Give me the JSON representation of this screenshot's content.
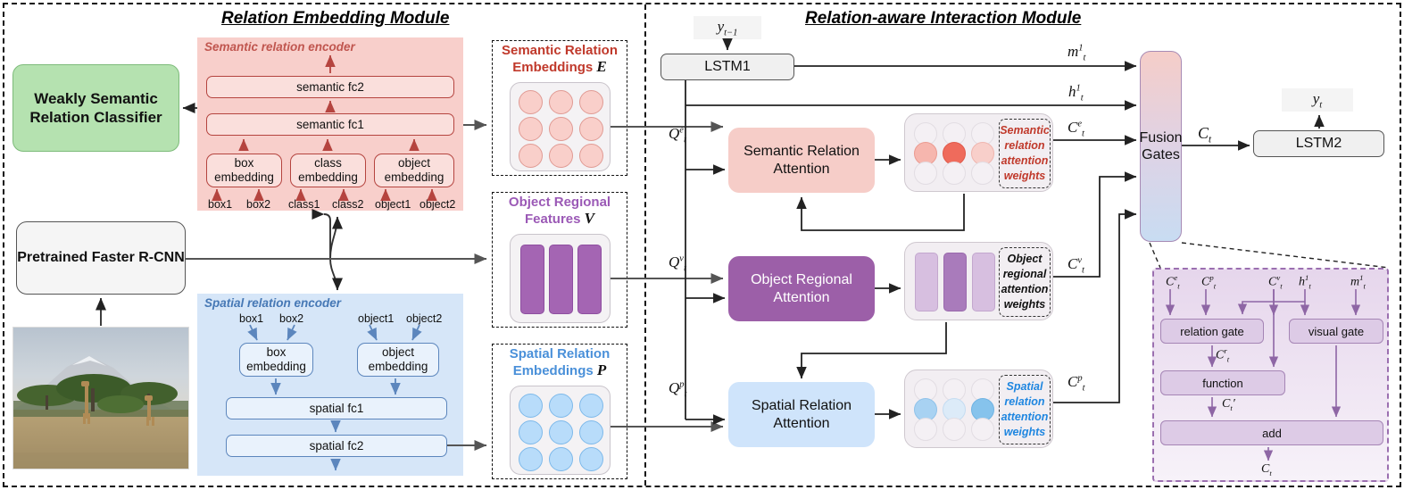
{
  "modules": {
    "left_title": "Relation Embedding Module",
    "right_title": "Relation-aware Interaction Module"
  },
  "left": {
    "classifier": "Weakly Semantic Relation Classifier",
    "detector": "Pretrained Faster R-CNN",
    "image_alt": "giraffes-savanna-photo",
    "semantic_encoder": {
      "title": "Semantic relation encoder",
      "fc2": "semantic fc2",
      "fc1": "semantic fc1",
      "embeddings": [
        "box embedding",
        "class embedding",
        "object embedding"
      ],
      "inputs": [
        "box1",
        "box2",
        "class1",
        "class2",
        "object1",
        "object2"
      ]
    },
    "spatial_encoder": {
      "title": "Spatial relation encoder",
      "inputs": [
        "box1",
        "box2",
        "object1",
        "object2"
      ],
      "embeddings": [
        "box embedding",
        "object embedding"
      ],
      "fc1": "spatial fc1",
      "fc2": "spatial fc2"
    }
  },
  "middle": {
    "groups": [
      {
        "name": "semantic-relation-embeddings",
        "line1": "Semantic Relation",
        "line2": "Embeddings",
        "symbol": "E",
        "color": "#c0392b",
        "shape": "circles",
        "rows": 3,
        "cols": 3,
        "fill": "#f9cfca",
        "stroke": "#e09a93"
      },
      {
        "name": "object-regional-features",
        "line1": "Object Regional",
        "line2": "Features",
        "symbol": "V",
        "color": "#9b59b6",
        "shape": "bars",
        "count": 3,
        "fill": "#a465b3",
        "stroke": "#8e4fa0"
      },
      {
        "name": "spatial-relation-embeddings",
        "line1": "Spatial Relation",
        "line2": "Embeddings",
        "symbol": "P",
        "color": "#4a90d9",
        "shape": "circles",
        "rows": 3,
        "cols": 3,
        "fill": "#b8dcfa",
        "stroke": "#7db9ea"
      }
    ]
  },
  "right": {
    "input_prev_word": "y_{t-1}",
    "lstm1": "LSTM1",
    "lstm2": "LSTM2",
    "output_word": "y_t",
    "fusion_gates": "Fusion Gates",
    "attentions": [
      {
        "name": "semantic-relation-attention",
        "label": "Semantic Relation Attention",
        "query": "Q_t^e",
        "context": "C_t^e",
        "weights_label": [
          "Semantic",
          "relation",
          "attention",
          "weights"
        ],
        "weights_color": "#c0392b"
      },
      {
        "name": "object-regional-attention",
        "label": "Object Regional Attention",
        "query": "Q_t^v",
        "context": "C_t^v",
        "weights_label": [
          "Object",
          "regional",
          "attention",
          "weights"
        ],
        "weights_color": "#111111"
      },
      {
        "name": "spatial-relation-attention",
        "label": "Spatial Relation Attention",
        "query": "Q_t^p",
        "context": "C_t^p",
        "weights_label": [
          "Spatial",
          "relation",
          "attention",
          "weights"
        ],
        "weights_color": "#1f86e0"
      }
    ],
    "hidden_state": "h_t^1",
    "memory_state": "m_t^1",
    "context_out": "C_t"
  },
  "gate_detail": {
    "inputs": [
      "C_t^e",
      "C_t^p",
      "C_t^v",
      "h_t^1",
      "m_t^1"
    ],
    "relation_gate": "relation gate",
    "visual_gate": "visual gate",
    "function": "function",
    "add": "add",
    "mid_label_r": "C_t^r",
    "mid_label_prime": "C_t'",
    "output": "C_t"
  },
  "colors": {
    "semantic": "#f8cfcb",
    "spatial": "#d6e6f8",
    "object": "#9c5fa8",
    "green": "#b5e2b0",
    "gate_purple": "#9b6fb0"
  }
}
